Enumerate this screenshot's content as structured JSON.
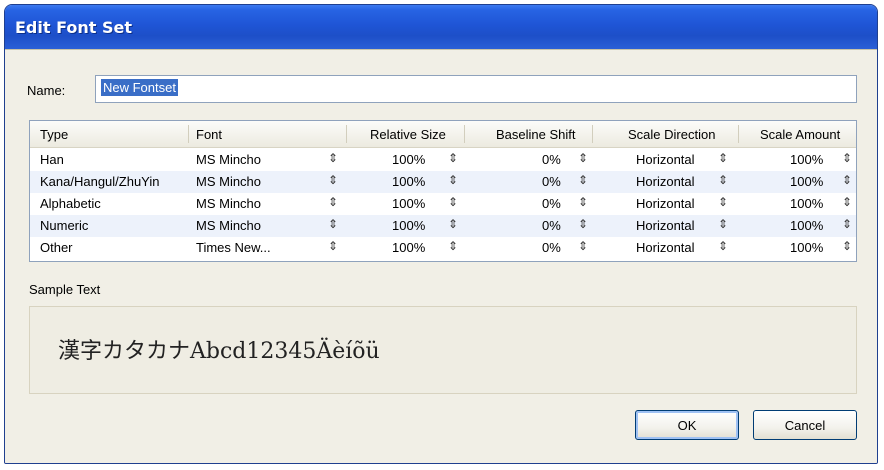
{
  "window": {
    "title": "Edit Font Set"
  },
  "name_field": {
    "label": "Name:",
    "value": "New Fontset"
  },
  "table": {
    "headers": [
      "Type",
      "Font",
      "Relative Size",
      "Baseline Shift",
      "Scale Direction",
      "Scale Amount"
    ],
    "rows": [
      {
        "type": "Han",
        "font": "MS Mincho",
        "relative_size": "100%",
        "baseline_shift": "0%",
        "scale_direction": "Horizontal",
        "scale_amount": "100%"
      },
      {
        "type": "Kana/Hangul/ZhuYin",
        "font": "MS Mincho",
        "relative_size": "100%",
        "baseline_shift": "0%",
        "scale_direction": "Horizontal",
        "scale_amount": "100%"
      },
      {
        "type": "Alphabetic",
        "font": "MS Mincho",
        "relative_size": "100%",
        "baseline_shift": "0%",
        "scale_direction": "Horizontal",
        "scale_amount": "100%"
      },
      {
        "type": "Numeric",
        "font": "MS Mincho",
        "relative_size": "100%",
        "baseline_shift": "0%",
        "scale_direction": "Horizontal",
        "scale_amount": "100%"
      },
      {
        "type": "Other",
        "font": "Times New...",
        "relative_size": "100%",
        "baseline_shift": "0%",
        "scale_direction": "Horizontal",
        "scale_amount": "100%"
      }
    ],
    "spinner_glyph": "⇕"
  },
  "sample": {
    "label": "Sample Text",
    "text": "漢字カタカナAbcd12345Äèíõü"
  },
  "buttons": {
    "ok": "OK",
    "cancel": "Cancel"
  },
  "colors": {
    "titlebar": "#1f55d6",
    "selection": "#3a6ec7",
    "alt_row": "#edf2fb"
  }
}
